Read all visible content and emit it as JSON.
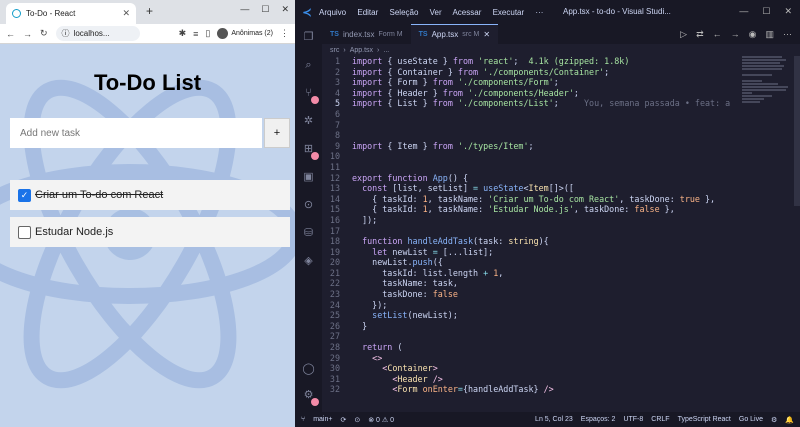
{
  "browser": {
    "tab_title": "To-Do - React",
    "url": "localhos...",
    "profile_label": "Anônimas (2)"
  },
  "app": {
    "title": "To-Do List",
    "input_placeholder": "Add new task",
    "add_button": "+",
    "tasks": [
      {
        "label": "Criar um To-do com React",
        "done": true
      },
      {
        "label": "Estudar Node.js",
        "done": false
      }
    ]
  },
  "vscode": {
    "menu": [
      "Arquivo",
      "Editar",
      "Seleção",
      "Ver",
      "Acessar",
      "Executar",
      "···"
    ],
    "window_title": "App.tsx - to-do - Visual Studi...",
    "tabs": [
      {
        "icon": "TS",
        "name": "index.tsx",
        "path": "Form M",
        "active": false
      },
      {
        "icon": "TS",
        "name": "App.tsx",
        "path": "src M",
        "active": true
      }
    ],
    "breadcrumb": [
      "src",
      "App.tsx",
      "..."
    ],
    "blame": "You, semana passada • feat: a",
    "statusbar": {
      "branch": "main+",
      "problems": "⊗ 0 ⚠ 0",
      "cursor": "Ln 5, Col 23",
      "spaces": "Espaços: 2",
      "encoding": "UTF-8",
      "eol": "CRLF",
      "language": "TypeScript React",
      "golive": "Go Live"
    }
  },
  "colors": {
    "vscode_bg": "#1e1e2e",
    "app_bg": "#c3d4ec",
    "checkbox_blue": "#1a73e8"
  }
}
